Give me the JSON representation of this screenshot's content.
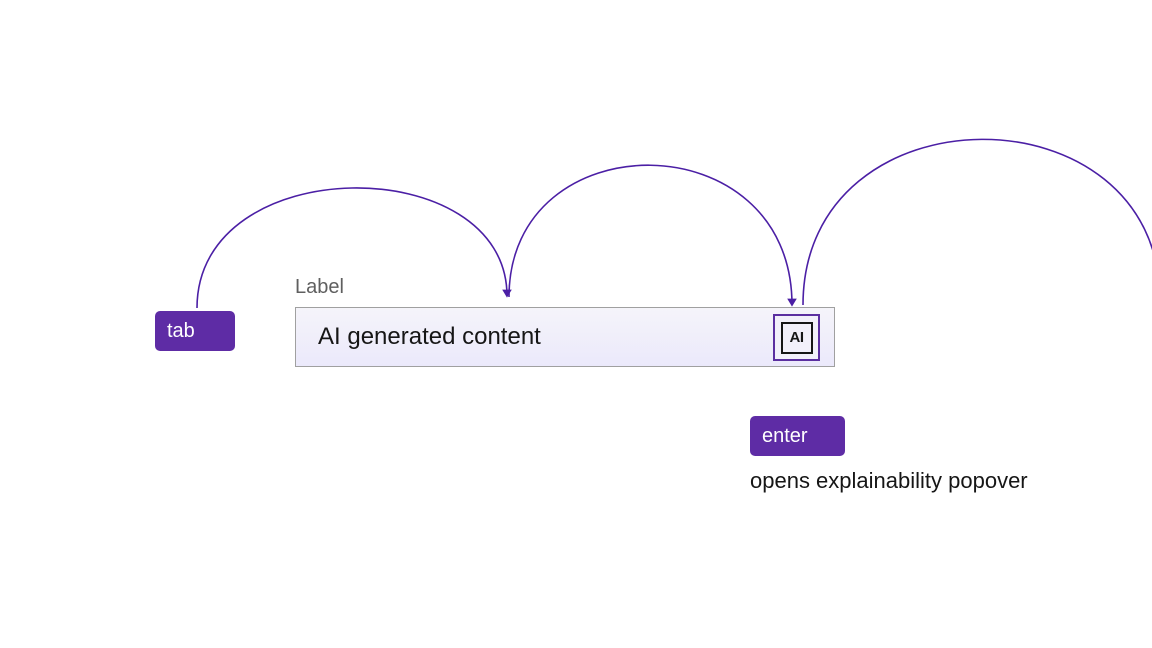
{
  "colors": {
    "accent": "#5e2ca5",
    "arcStroke": "#4b1fa5",
    "labelGray": "#5f5f5f",
    "text": "#161616"
  },
  "keys": {
    "tab": "tab",
    "enter": "enter"
  },
  "field": {
    "label": "Label",
    "content": "AI generated content",
    "icon_label": "AI"
  },
  "captions": {
    "enter": "opens explainability popover"
  }
}
